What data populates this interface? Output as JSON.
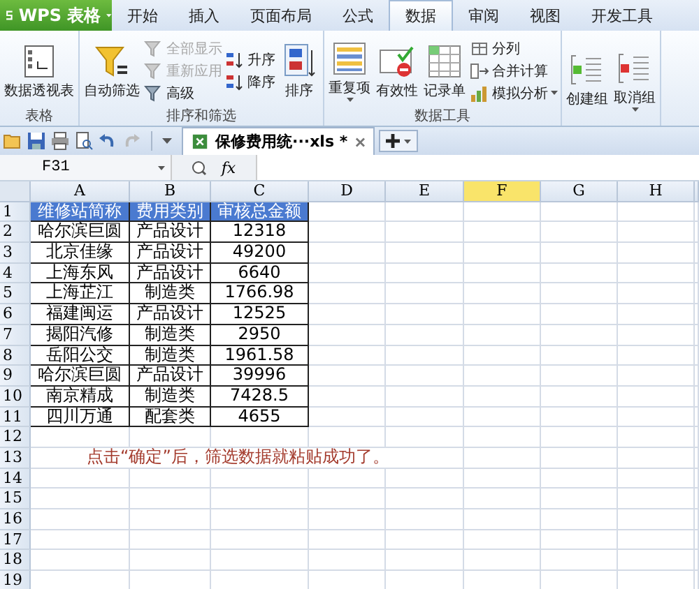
{
  "app_button": {
    "label": "WPS 表格"
  },
  "ribbon_tabs": [
    {
      "label": "开始",
      "selected": false
    },
    {
      "label": "插入",
      "selected": false
    },
    {
      "label": "页面布局",
      "selected": false
    },
    {
      "label": "公式",
      "selected": false
    },
    {
      "label": "数据",
      "selected": true
    },
    {
      "label": "审阅",
      "selected": false
    },
    {
      "label": "视图",
      "selected": false
    },
    {
      "label": "开发工具",
      "selected": false
    }
  ],
  "ribbon_groups": [
    {
      "label": "表格",
      "columns": [
        {
          "items": [
            {
              "label": "数据透视表",
              "kind": "large",
              "disabled": false,
              "has_menu": false
            }
          ]
        }
      ]
    },
    {
      "label": "排序和筛选",
      "columns": [
        {
          "items": [
            {
              "label": "自动筛选",
              "kind": "large",
              "disabled": false,
              "has_menu": false
            }
          ]
        },
        {
          "items": [
            {
              "label": "全部显示",
              "kind": "small",
              "disabled": true,
              "has_menu": false
            },
            {
              "label": "重新应用",
              "kind": "small",
              "disabled": true,
              "has_menu": false
            },
            {
              "label": "高级",
              "kind": "small",
              "disabled": false,
              "has_menu": false
            }
          ]
        },
        {
          "items": [
            {
              "label": "升序",
              "kind": "small",
              "disabled": false,
              "has_menu": false
            },
            {
              "label": "降序",
              "kind": "small",
              "disabled": false,
              "has_menu": false
            }
          ]
        },
        {
          "items": [
            {
              "label": "排序",
              "kind": "large",
              "disabled": false,
              "has_menu": false
            }
          ]
        }
      ]
    },
    {
      "label": "数据工具",
      "columns": [
        {
          "items": [
            {
              "label": "重复项",
              "kind": "large",
              "disabled": false,
              "has_menu": true
            }
          ]
        },
        {
          "items": [
            {
              "label": "有效性",
              "kind": "large",
              "disabled": false,
              "has_menu": false
            }
          ]
        },
        {
          "items": [
            {
              "label": "记录单",
              "kind": "large",
              "disabled": false,
              "has_menu": false
            }
          ]
        },
        {
          "items": [
            {
              "label": "分列",
              "kind": "small",
              "disabled": false,
              "has_menu": false
            },
            {
              "label": "合并计算",
              "kind": "small",
              "disabled": false,
              "has_menu": false
            },
            {
              "label": "模拟分析",
              "kind": "small",
              "disabled": false,
              "has_menu": true
            }
          ]
        }
      ]
    },
    {
      "columns": [
        {
          "items": [
            {
              "label": "创建组",
              "kind": "large",
              "disabled": false,
              "has_menu": false
            }
          ]
        },
        {
          "items": [
            {
              "label": "取消组",
              "kind": "large",
              "disabled": false,
              "has_menu": true
            }
          ]
        }
      ]
    }
  ],
  "document_tab": {
    "title": "保修费用统···xls *"
  },
  "formula_bar": {
    "cell_name": "F31",
    "fx_label": "fx"
  },
  "sheet": {
    "columns": [
      {
        "label": "A",
        "selected": false
      },
      {
        "label": "B",
        "selected": false
      },
      {
        "label": "C",
        "selected": false
      },
      {
        "label": "D",
        "selected": false
      },
      {
        "label": "E",
        "selected": false
      },
      {
        "label": "F",
        "selected": true
      },
      {
        "label": "G",
        "selected": false
      },
      {
        "label": "H",
        "selected": false
      }
    ],
    "rows": [
      {
        "number": "1",
        "kind": "header",
        "cells": [
          "维修站简称",
          "费用类别",
          "审核总金额"
        ]
      },
      {
        "number": "2",
        "kind": "data",
        "cells": [
          "哈尔滨巨圆",
          "产品设计",
          "12318"
        ]
      },
      {
        "number": "3",
        "kind": "data",
        "cells": [
          "北京佳缘",
          "产品设计",
          "49200"
        ]
      },
      {
        "number": "4",
        "kind": "data",
        "cells": [
          "上海东风",
          "产品设计",
          "6640"
        ]
      },
      {
        "number": "5",
        "kind": "data",
        "cells": [
          "上海芷江",
          "制造类",
          "1766.98"
        ]
      },
      {
        "number": "6",
        "kind": "data",
        "cells": [
          "福建闽运",
          "产品设计",
          "12525"
        ]
      },
      {
        "number": "7",
        "kind": "data",
        "cells": [
          "揭阳汽修",
          "制造类",
          "2950"
        ]
      },
      {
        "number": "8",
        "kind": "data",
        "cells": [
          "岳阳公交",
          "制造类",
          "1961.58"
        ]
      },
      {
        "number": "9",
        "kind": "data",
        "cells": [
          "哈尔滨巨圆",
          "产品设计",
          "39996"
        ]
      },
      {
        "number": "10",
        "kind": "data",
        "cells": [
          "南京精成",
          "制造类",
          "7428.5"
        ]
      },
      {
        "number": "11",
        "kind": "data",
        "cells": [
          "四川万通",
          "配套类",
          "4655"
        ]
      },
      {
        "number": "12",
        "kind": "empty"
      },
      {
        "number": "13",
        "kind": "note",
        "text": "点击“确定”后，筛选数据就粘贴成功了。"
      },
      {
        "number": "14",
        "kind": "empty"
      },
      {
        "number": "15",
        "kind": "empty"
      },
      {
        "number": "16",
        "kind": "empty"
      },
      {
        "number": "17",
        "kind": "empty"
      },
      {
        "number": "18",
        "kind": "empty"
      },
      {
        "number": "19",
        "kind": "empty"
      }
    ]
  }
}
